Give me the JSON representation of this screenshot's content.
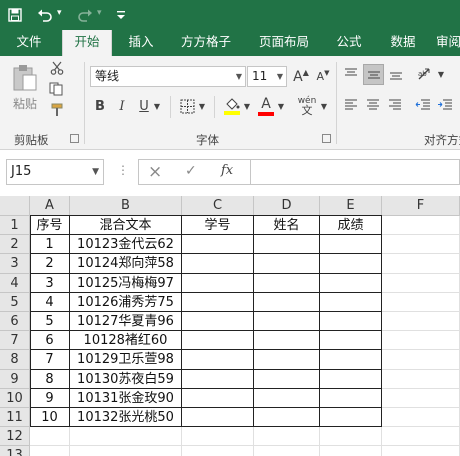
{
  "tabs": [
    "文件",
    "开始",
    "插入",
    "方方格子",
    "页面布局",
    "公式",
    "数据",
    "审阅"
  ],
  "ribbon": {
    "paste_label": "粘贴",
    "clipboard_label": "剪贴板",
    "font_group_label": "字体",
    "align_group_label": "对齐方式",
    "font_name": "等线",
    "font_size": "11",
    "font_size_up": "A",
    "font_size_down": "A",
    "bold": "B",
    "italic": "I",
    "underline": "U",
    "font_color_letter": "A",
    "wen_top": "wén",
    "wen_bottom": "文",
    "fill_color": "#ffff00",
    "font_color": "#ff0000"
  },
  "formula_bar": {
    "cell_ref": "J15",
    "cancel_icon": "×",
    "enter_icon": "✓",
    "fx_label": "fx",
    "value": ""
  },
  "sheet": {
    "columns": [
      "A",
      "B",
      "C",
      "D",
      "E",
      "F"
    ],
    "row_numbers": [
      "1",
      "2",
      "3",
      "4",
      "5",
      "6",
      "7",
      "8",
      "9",
      "10",
      "11",
      "12",
      "13"
    ],
    "rows": [
      [
        "序号",
        "混合文本",
        "学号",
        "姓名",
        "成绩"
      ],
      [
        "1",
        "10123金代云62",
        "",
        "",
        ""
      ],
      [
        "2",
        "10124郑向萍58",
        "",
        "",
        ""
      ],
      [
        "3",
        "10125冯梅梅97",
        "",
        "",
        ""
      ],
      [
        "4",
        "10126浦秀芳75",
        "",
        "",
        ""
      ],
      [
        "5",
        "10127华夏青96",
        "",
        "",
        ""
      ],
      [
        "6",
        "10128褚红60",
        "",
        "",
        ""
      ],
      [
        "7",
        "10129卫乐萱98",
        "",
        "",
        ""
      ],
      [
        "8",
        "10130苏夜白59",
        "",
        "",
        ""
      ],
      [
        "9",
        "10131张金玫90",
        "",
        "",
        ""
      ],
      [
        "10",
        "10132张光桃50",
        "",
        "",
        ""
      ]
    ]
  }
}
